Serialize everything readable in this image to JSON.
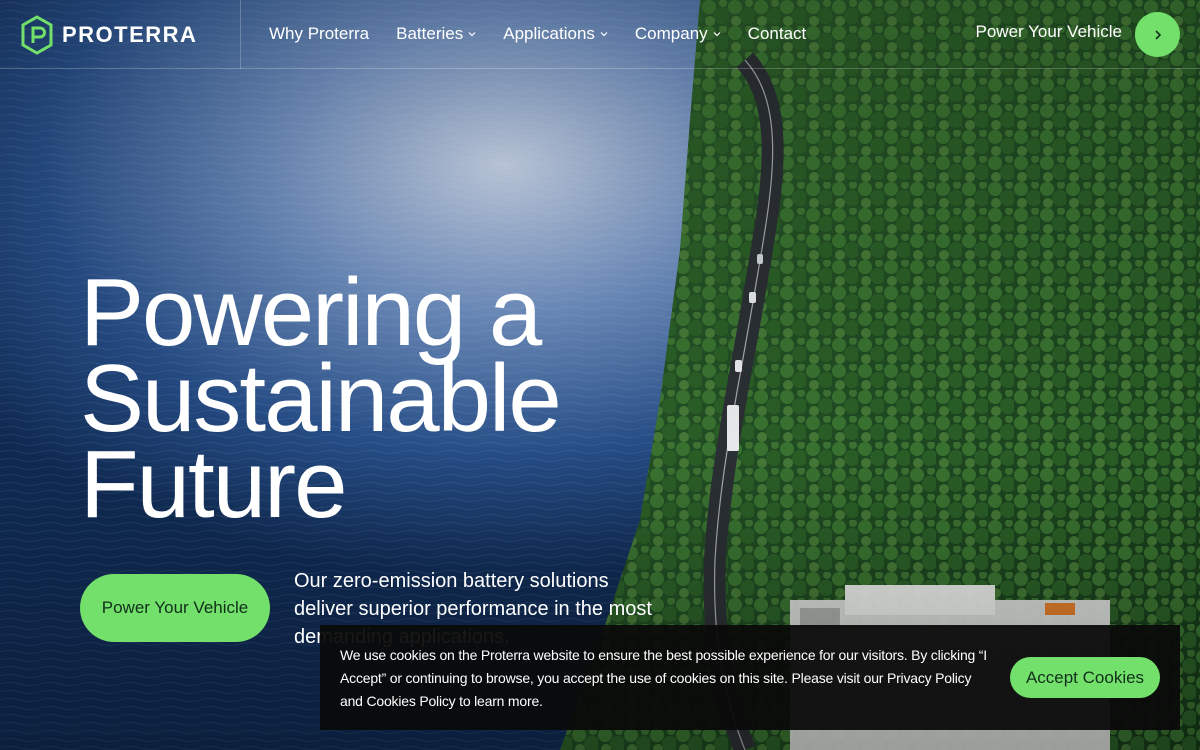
{
  "brand": {
    "name": "PROTERRA",
    "accent": "#72e06a"
  },
  "nav": {
    "items": [
      {
        "label": "Why Proterra",
        "has_dropdown": false
      },
      {
        "label": "Batteries",
        "has_dropdown": true
      },
      {
        "label": "Applications",
        "has_dropdown": true
      },
      {
        "label": "Company",
        "has_dropdown": true
      },
      {
        "label": "Contact",
        "has_dropdown": false
      }
    ],
    "cta_label": "Power Your Vehicle",
    "cta_icon": "chevron-right-icon"
  },
  "hero": {
    "title_lines": [
      "Powering a",
      "Sustainable",
      "Future"
    ],
    "button_label": "Power Your Vehicle",
    "description": "Our zero-emission battery solutions deliver superior performance in the most demanding applications."
  },
  "cookie": {
    "text": "We use cookies on the Proterra website to ensure the best possible experience for our visitors. By clicking “I Accept” or continuing to browse, you accept the use of cookies on this site. Please visit our Privacy Policy and Cookies Policy to learn more.",
    "button_label": "Accept Cookies"
  },
  "background": {
    "description_icon": "aerial-forest-lake-road-image"
  }
}
